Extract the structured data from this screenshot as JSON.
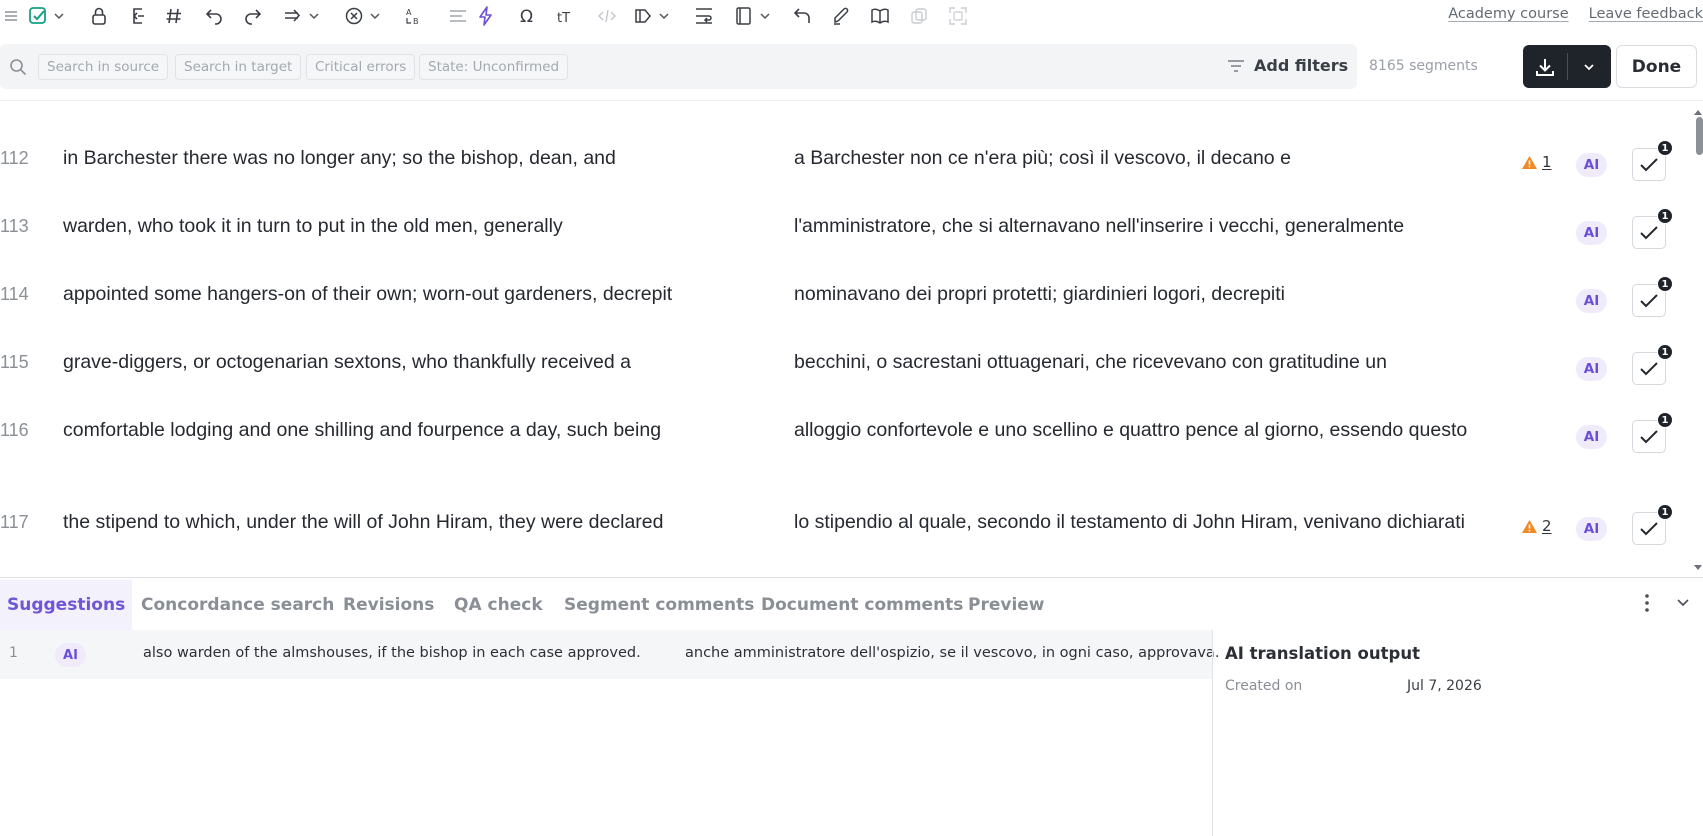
{
  "toolbar": {
    "icons": [
      "menu-icon",
      "confirm-check-icon",
      "lock-icon",
      "join-segments-icon",
      "hashtag-icon",
      "undo-icon",
      "redo-icon",
      "copy-source-icon",
      "clear-icon",
      "tag-case-icon",
      "align-icon",
      "lightning-icon",
      "omega-icon",
      "text-format-icon",
      "code-icon",
      "tag-icon",
      "wrap-icon",
      "book-icon",
      "revert-icon",
      "pen-icon",
      "reader-icon",
      "duplicate-icon",
      "fullscreen-icon"
    ],
    "links": {
      "academy": "Academy course",
      "feedback": "Leave feedback"
    },
    "accent_color": "#14a085"
  },
  "filters": {
    "chips": [
      "Search in source",
      "Search in target",
      "Critical errors",
      "State: Unconfirmed"
    ],
    "add_filters": "Add filters",
    "segment_count": "8165 segments",
    "done": "Done"
  },
  "segments": [
    {
      "num": "112",
      "source": "in Barchester there was no longer any; so the bishop, dean, and",
      "target": "a Barchester non ce n'era più; così il vescovo, il decano e",
      "qa": "1",
      "ai": "AI",
      "confirm_count": "1"
    },
    {
      "num": "113",
      "source": "warden, who took it in turn to put in the old men, generally",
      "target": "l'amministratore, che si alternavano nell'inserire i vecchi, generalmente",
      "qa": "",
      "ai": "AI",
      "confirm_count": "1"
    },
    {
      "num": "114",
      "source": "appointed some hangers-on of their own; worn-out gardeners, decrepit",
      "target": "nominavano dei propri protetti; giardinieri logori, decrepiti",
      "qa": "",
      "ai": "AI",
      "confirm_count": "1"
    },
    {
      "num": "115",
      "source": "grave-diggers, or octogenarian sextons, who thankfully received a",
      "target": "becchini, o sacrestani ottuagenari, che ricevevano con gratitudine un",
      "qa": "",
      "ai": "AI",
      "confirm_count": "1"
    },
    {
      "num": "116",
      "source": "comfortable lodging and one shilling and fourpence a day, such being",
      "target": "alloggio confortevole e uno scellino e quattro pence al giorno, essendo questo",
      "qa": "",
      "ai": "AI",
      "confirm_count": "1"
    },
    {
      "num": "117",
      "source": "the stipend to which, under the will of John Hiram, they were declared",
      "target": "lo stipendio al quale, secondo il testamento di John Hiram, venivano dichiarati",
      "qa": "2",
      "ai": "AI",
      "confirm_count": "1"
    }
  ],
  "partial_row": {
    "ai": "AI"
  },
  "bottom_panel": {
    "tabs": [
      "Suggestions",
      "Concordance search",
      "Revisions",
      "QA check",
      "Segment comments",
      "Document comments",
      "Preview"
    ],
    "active_tab": "Suggestions",
    "suggestion": {
      "num": "1",
      "badge": "AI",
      "source": "also warden of the almshouses, if the bishop in each case approved.",
      "target": "anche amministratore dell'ospizio, se il vescovo, in ogni caso, approvava."
    },
    "details": {
      "title": "AI translation output",
      "created_label": "Created on",
      "created_value": "Jul 7, 2026"
    }
  }
}
